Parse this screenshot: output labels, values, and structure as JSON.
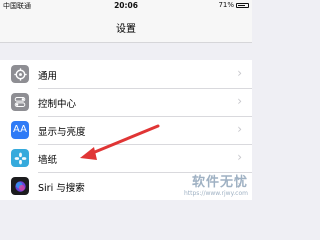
{
  "status_bar": {
    "carrier": "中国联通",
    "time": "20:06",
    "battery": "71%"
  },
  "nav": {
    "title": "设置"
  },
  "colors": {
    "general": "#8e8e93",
    "control_center": "#8e8e93",
    "display": "#2f7bf6",
    "wallpaper": "#35aadc",
    "siri": "#1c1c1e",
    "arrow": "#e03535"
  },
  "rows": [
    {
      "label": "通用",
      "icon": "gear-icon"
    },
    {
      "label": "控制中心",
      "icon": "toggles-icon"
    },
    {
      "label": "显示与亮度",
      "icon": "aa-icon",
      "icon_text": "AA"
    },
    {
      "label": "墙纸",
      "icon": "flower-icon"
    },
    {
      "label": "Siri 与搜索",
      "icon": "siri-icon"
    }
  ],
  "watermark": {
    "main": "软件无忧",
    "sub": "https://www.rjwy.com"
  }
}
